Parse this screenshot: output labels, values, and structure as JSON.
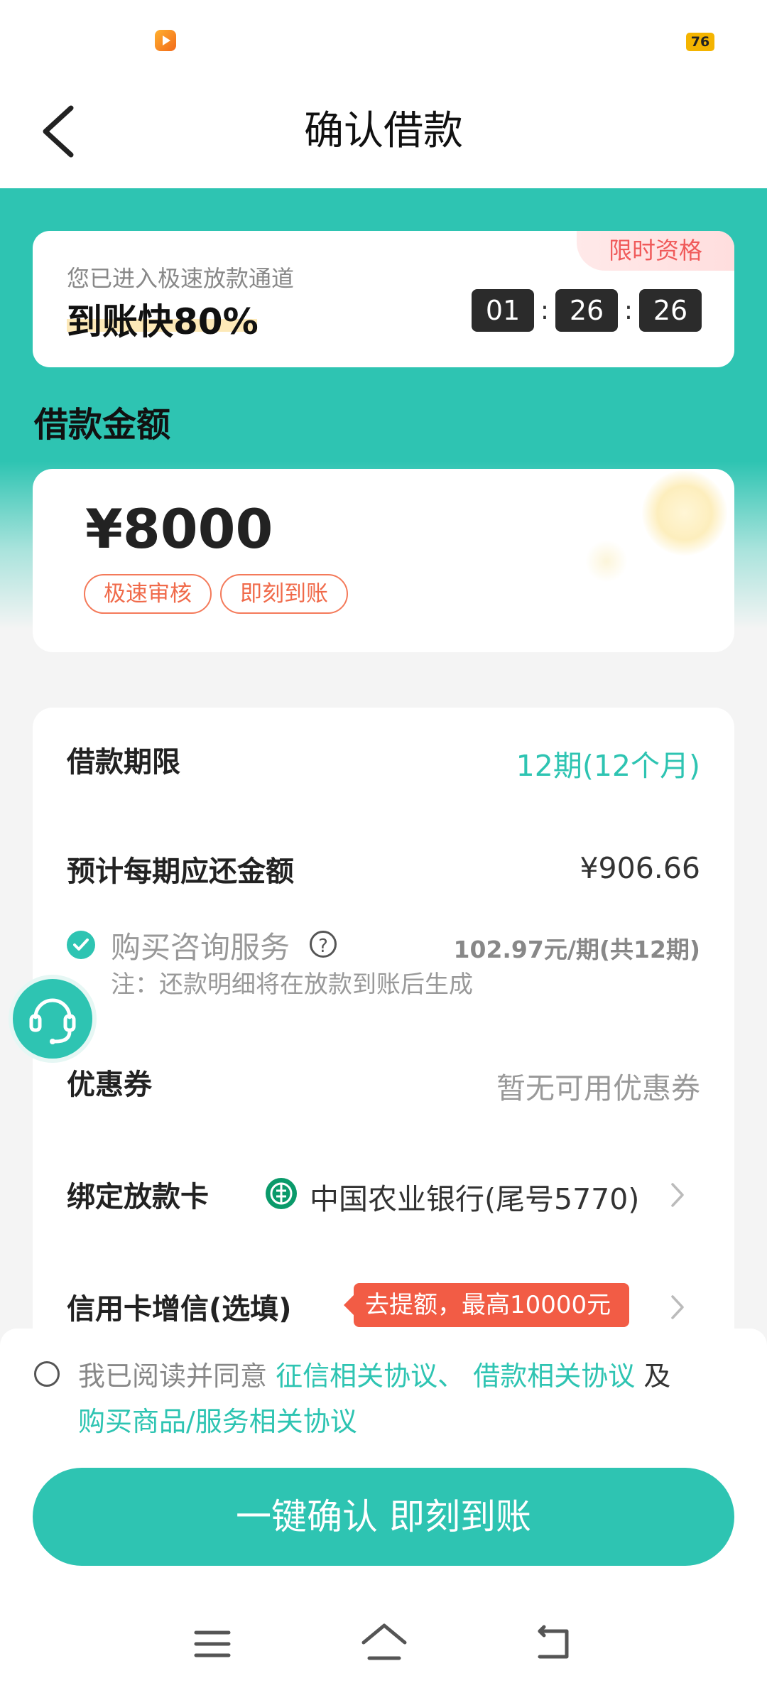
{
  "status_bar": {
    "battery": "76"
  },
  "header": {
    "title": "确认借款"
  },
  "promo": {
    "badge": "限时资格",
    "subtitle": "您已进入极速放款通道",
    "headline": "到账快80%",
    "timer": {
      "hours": "01",
      "minutes": "26",
      "seconds": "26",
      "separator": ":"
    }
  },
  "amount_section": {
    "title": "借款金额",
    "amount": "¥8000",
    "tags": [
      "极速审核",
      "即刻到账"
    ]
  },
  "details": {
    "term": {
      "label": "借款期限",
      "value": "12期(12个月)"
    },
    "installment": {
      "label": "预计每期应还金额",
      "value": "¥906.66"
    },
    "service": {
      "label": "购买咨询服务",
      "help": "?",
      "price": "102.97元/期(共12期)",
      "note": "注：还款明细将在放款到账后生成",
      "checked": true
    },
    "coupon": {
      "label": "优惠券",
      "value": "暂无可用优惠券"
    },
    "bank": {
      "label": "绑定放款卡",
      "value": "中国农业银行(尾号5770)"
    },
    "credit": {
      "label": "信用卡增信(选填)",
      "tag": "去提额，最高10000元"
    }
  },
  "agreement": {
    "prefix": "我已阅读并同意",
    "link1": "征信相关协议、",
    "link2": "借款相关协议",
    "and": "及",
    "link3": "购买商品/服务相关协议"
  },
  "confirm_button": "一键确认 即刻到账",
  "colors": {
    "accent": "#2ec4b2",
    "warning": "#f05a5a",
    "tag_border": "#f47a5a"
  }
}
